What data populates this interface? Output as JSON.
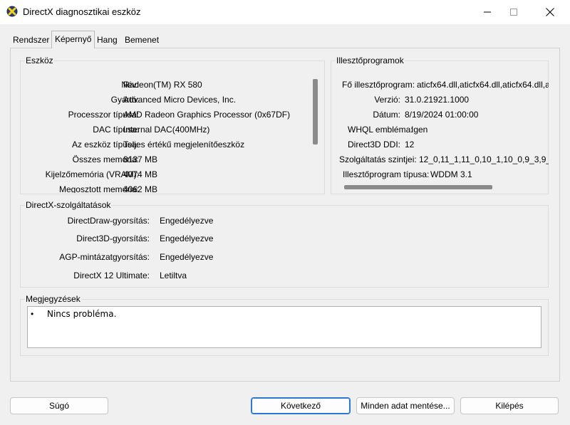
{
  "window": {
    "title": "DirectX diagnosztikai eszköz"
  },
  "tabs": [
    "Rendszer",
    "Képernyő",
    "Hang",
    "Bemenet"
  ],
  "active_tab": "Képernyő",
  "device": {
    "title": "Eszköz",
    "rows": [
      {
        "label": "Név:",
        "value": "Radeon(TM) RX 580"
      },
      {
        "label": "Gyártó:",
        "value": "Advanced Micro Devices, Inc."
      },
      {
        "label": "Processzor típusa:",
        "value": "AMD Radeon Graphics Processor (0x67DF)"
      },
      {
        "label": "DAC típusa:",
        "value": "Internal DAC(400MHz)"
      },
      {
        "label": "Az eszköz típusa:",
        "value": "Teljes értékű megjelenítőeszköz"
      },
      {
        "label": "Összes memória:",
        "value": "8137 MB"
      },
      {
        "label": "Kijelzőmemória (VRAM):",
        "value": "4074 MB"
      },
      {
        "label": "Megosztott memória:",
        "value": "4062 MB"
      }
    ]
  },
  "drivers": {
    "title": "Illesztőprogramok",
    "rows": [
      {
        "label": "Fő illesztőprogram:",
        "value": "aticfx64.dll,aticfx64.dll,aticfx64.dll,a"
      },
      {
        "label": "Verzió:",
        "value": "31.0.21921.1000"
      },
      {
        "label": "Dátum:",
        "value": "8/19/2024 01:00:00"
      },
      {
        "label": "WHQL embléma:",
        "value": "Igen"
      },
      {
        "label": "Direct3D DDI:",
        "value": "12"
      },
      {
        "label": "Szolgáltatás szintjei:",
        "value": "12_0,11_1,11_0,10_1,10_0,9_3,9_"
      },
      {
        "label": "Illesztőprogram típusa:",
        "value": "WDDM 3.1"
      }
    ]
  },
  "dx_features": {
    "title": "DirectX-szolgáltatások",
    "rows": [
      {
        "label": "DirectDraw-gyorsítás:",
        "value": "Engedélyezve"
      },
      {
        "label": "Direct3D-gyorsítás:",
        "value": "Engedélyezve"
      },
      {
        "label": "AGP-mintázatgyorsítás:",
        "value": "Engedélyezve"
      },
      {
        "label": "DirectX 12 Ultimate:",
        "value": "Letiltva"
      }
    ]
  },
  "notes": {
    "title": "Megjegyzések",
    "bullet": "•",
    "items": [
      "Nincs probléma."
    ]
  },
  "buttons": {
    "help": "Súgó",
    "next": "Következő",
    "save_all": "Minden adat mentése...",
    "exit": "Kilépés"
  },
  "icons": {
    "app": "directx-icon",
    "minimize": "minimize-icon",
    "maximize": "maximize-icon",
    "close": "close-icon"
  }
}
